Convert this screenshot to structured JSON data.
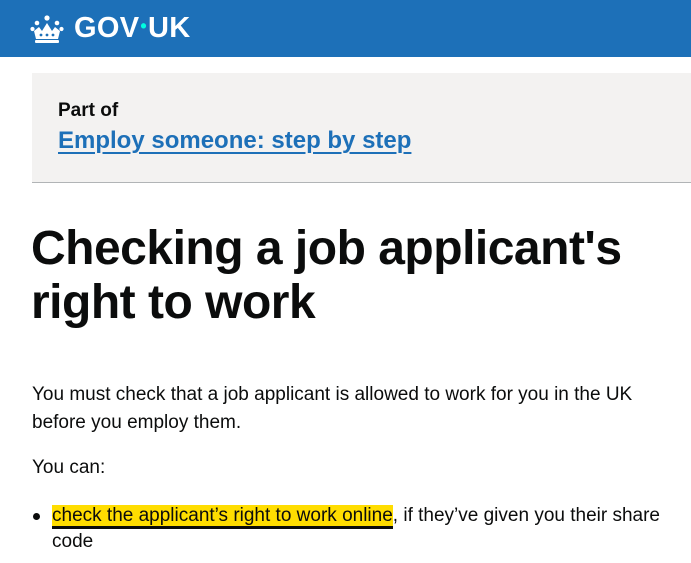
{
  "header": {
    "logo_text_left": "GOV",
    "logo_dot": "•",
    "logo_text_right": "UK",
    "icon": "crown-icon",
    "background_color": "#1d70b8"
  },
  "part_of": {
    "label": "Part of",
    "link_text": "Employ someone: step by step"
  },
  "page": {
    "title": "Checking a job applicant's right to work",
    "intro": "You must check that a job applicant is allowed to work for you in the UK before you employ them.",
    "you_can": "You can:",
    "bullets": [
      {
        "link_text": "check the applicant’s right to work online",
        "rest_text": ", if they’ve given you their share code"
      }
    ]
  },
  "colors": {
    "link": "#1d70b8",
    "focus": "#ffdd00",
    "text": "#0b0c0c",
    "panel": "#f3f2f1"
  }
}
